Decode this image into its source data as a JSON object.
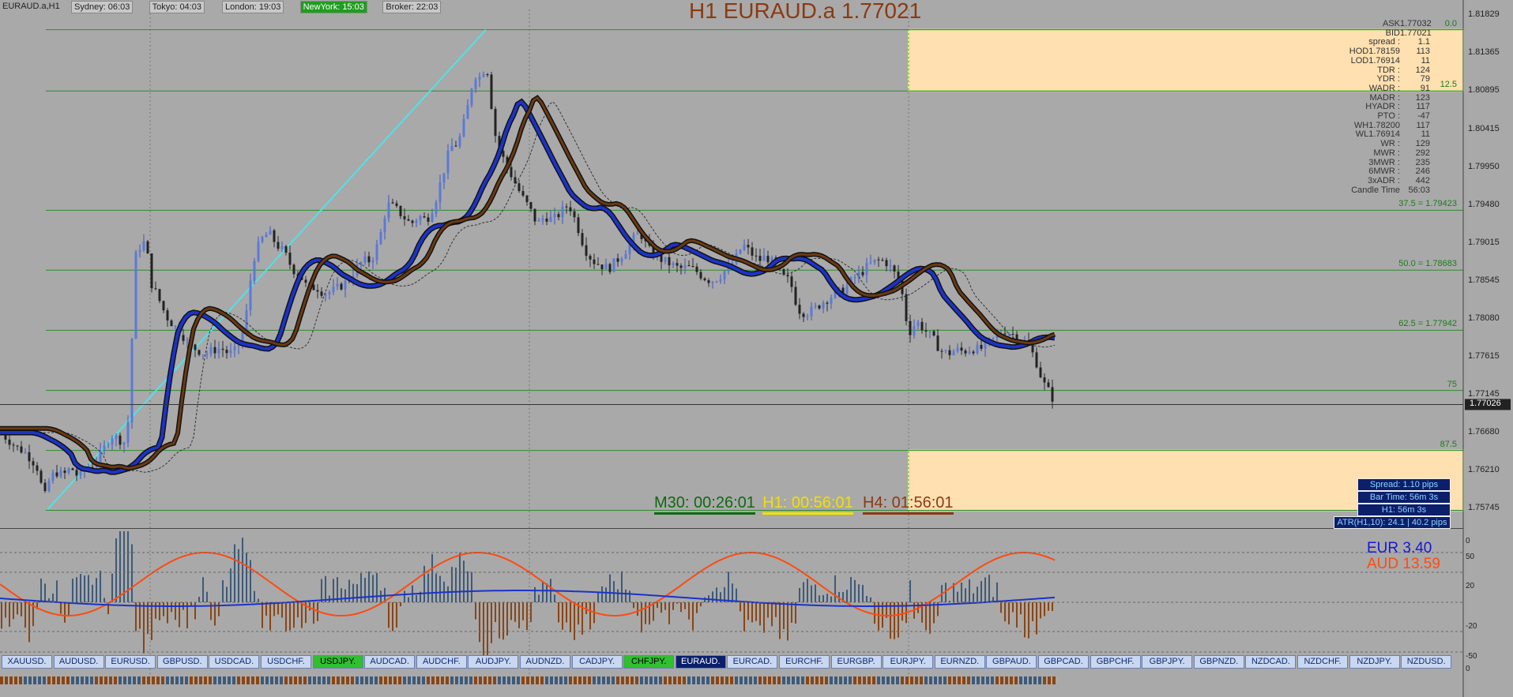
{
  "chart_title": "EURAUD.a,H1",
  "big_title": "H1 EURAUD.a 1.77021",
  "sessions": [
    {
      "label": "Sydney: 06:03",
      "bg": "#c8c8c8"
    },
    {
      "label": "Tokyo: 04:03",
      "bg": "#c8c8c8"
    },
    {
      "label": "London: 19:03",
      "bg": "#c8c8c8"
    },
    {
      "label": "NewYork: 15:03",
      "bg": "#1f9d1f"
    },
    {
      "label": "Broker: 22:03",
      "bg": "#c8c8c8"
    }
  ],
  "price_axis": [
    "1.81829",
    "1.81365",
    "1.80895",
    "1.80415",
    "1.79950",
    "1.79480",
    "1.79015",
    "1.78545",
    "1.78080",
    "1.77615",
    "1.77145",
    "1.77026",
    "1.76680",
    "1.76210",
    "1.75745"
  ],
  "info_panel": [
    {
      "k": "ASK",
      "v": "1.77032"
    },
    {
      "k": "BID",
      "v": "1.77021"
    },
    {
      "k": "spread :",
      "v": "1.1"
    },
    {
      "k": "HOD1.78159",
      "v": "113"
    },
    {
      "k": "LOD1.76914",
      "v": "11"
    },
    {
      "k": "TDR :",
      "v": "124"
    },
    {
      "k": "YDR :",
      "v": "79"
    },
    {
      "k": "WADR :",
      "v": "91"
    },
    {
      "k": "MADR :",
      "v": "123"
    },
    {
      "k": "HYADR :",
      "v": "117"
    },
    {
      "k": "PTO :",
      "v": "-47"
    },
    {
      "k": "WH1.78200",
      "v": "117"
    },
    {
      "k": "WL1.76914",
      "v": "11"
    },
    {
      "k": "WR :",
      "v": "129"
    },
    {
      "k": "MWR :",
      "v": "292"
    },
    {
      "k": "3MWR :",
      "v": "235"
    },
    {
      "k": "6MWR :",
      "v": "246"
    },
    {
      "k": "3xADR :",
      "v": "442"
    },
    {
      "k": "Candle Time",
      "v": "56:03"
    }
  ],
  "fib_labels": [
    {
      "text": "0.0"
    },
    {
      "text": "12.5"
    },
    {
      "text": "37.5 = 1.79423"
    },
    {
      "text": "50.0  = 1.78683"
    },
    {
      "text": "62.5 = 1.77942"
    },
    {
      "text": "75"
    },
    {
      "text": "87.5"
    }
  ],
  "candle_timers": [
    {
      "text": "M30: 00:26:01",
      "color": "#0f6a0f"
    },
    {
      "text": "H1: 00:56:01",
      "color": "#f2e000"
    },
    {
      "text": "H4: 01:56:01",
      "color": "#8b3a12"
    }
  ],
  "info_boxes": [
    "Spread: 1.10 pips",
    "Bar Time: 56m 3s",
    "H1:  56m 3s",
    "ATR(H1,10): 24.1  |  40.2 pips"
  ],
  "strength": [
    {
      "ccy": "EUR",
      "val": "3.40",
      "color": "#1616d8"
    },
    {
      "ccy": "AUD",
      "val": "13.59",
      "color": "#ff4a10"
    }
  ],
  "indicator_axis": [
    "0",
    "50",
    "20",
    "-20",
    "-50",
    "0"
  ],
  "pair_tabs": [
    "XAUUSD.",
    "AUDUSD.",
    "EURUSD.",
    "GBPUSD.",
    "USDCAD.",
    "USDCHF.",
    "USDJPY.",
    "AUDCAD.",
    "AUDCHF.",
    "AUDJPY.",
    "AUDNZD.",
    "CADJPY.",
    "CHFJPY.",
    "EURAUD.",
    "EURCAD.",
    "EURCHF.",
    "EURGBP.",
    "EURJPY.",
    "EURNZD.",
    "GBPAUD.",
    "GBPCAD.",
    "GBPCHF.",
    "GBPJPY.",
    "GBPNZD.",
    "NZDCAD.",
    "NZDCHF.",
    "NZDJPY.",
    "NZDUSD."
  ],
  "active_tabs": [
    "USDJPY.",
    "CHFJPY."
  ],
  "selected_tab": "EURAUD.",
  "colors": {
    "ema_slow": "#6b3a12",
    "ema_fast": "#1c33c8",
    "trend": "#4fe3e8",
    "fib": "#2f8a2f",
    "zone": "#ffe0b0"
  },
  "chart_data": {
    "type": "candlestick",
    "symbol": "EURAUD.a",
    "timeframe": "H1",
    "ylim": [
      1.7555,
      1.819
    ],
    "last_price": 1.77026,
    "fib_levels": [
      {
        "level": "0.0",
        "price": 1.8165
      },
      {
        "level": "12.5",
        "price": 1.80895
      },
      {
        "level": "37.5",
        "price": 1.79423
      },
      {
        "level": "50.0",
        "price": 1.78683
      },
      {
        "level": "62.5",
        "price": 1.77942
      },
      {
        "level": "75",
        "price": 1.772
      },
      {
        "level": "87.5",
        "price": 1.7646
      },
      {
        "level": "100",
        "price": 1.7572
      }
    ],
    "close_path": [
      [
        0,
        1.7668
      ],
      [
        10,
        1.766
      ],
      [
        20,
        1.765
      ],
      [
        30,
        1.7645
      ],
      [
        40,
        1.7635
      ],
      [
        50,
        1.762
      ],
      [
        55,
        1.758
      ],
      [
        60,
        1.7605
      ],
      [
        70,
        1.762
      ],
      [
        80,
        1.7615
      ],
      [
        90,
        1.7625
      ],
      [
        100,
        1.7612
      ],
      [
        110,
        1.7625
      ],
      [
        120,
        1.763
      ],
      [
        130,
        1.7645
      ],
      [
        140,
        1.7665
      ],
      [
        150,
        1.766
      ],
      [
        160,
        1.7655
      ],
      [
        165,
        1.772
      ],
      [
        170,
        1.788
      ],
      [
        175,
        1.7895
      ],
      [
        180,
        1.79
      ],
      [
        185,
        1.7905
      ],
      [
        190,
        1.7855
      ],
      [
        200,
        1.7835
      ],
      [
        210,
        1.7812
      ],
      [
        220,
        1.78
      ],
      [
        230,
        1.779
      ],
      [
        240,
        1.7775
      ],
      [
        250,
        1.777
      ],
      [
        260,
        1.7765
      ],
      [
        270,
        1.777
      ],
      [
        280,
        1.7772
      ],
      [
        290,
        1.7765
      ],
      [
        300,
        1.777
      ],
      [
        310,
        1.78
      ],
      [
        320,
        1.788
      ],
      [
        330,
        1.7905
      ],
      [
        340,
        1.7915
      ],
      [
        350,
        1.79
      ],
      [
        360,
        1.789
      ],
      [
        370,
        1.787
      ],
      [
        380,
        1.7862
      ],
      [
        390,
        1.7845
      ],
      [
        400,
        1.7848
      ],
      [
        410,
        1.784
      ],
      [
        420,
        1.7842
      ],
      [
        430,
        1.7848
      ],
      [
        440,
        1.7855
      ],
      [
        450,
        1.787
      ],
      [
        460,
        1.788
      ],
      [
        470,
        1.788
      ],
      [
        480,
        1.7905
      ],
      [
        490,
        1.795
      ],
      [
        500,
        1.7945
      ],
      [
        510,
        1.7935
      ],
      [
        520,
        1.7925
      ],
      [
        530,
        1.7935
      ],
      [
        540,
        1.793
      ],
      [
        550,
        1.795
      ],
      [
        560,
        1.7985
      ],
      [
        570,
        1.802
      ],
      [
        580,
        1.8025
      ],
      [
        590,
        1.806
      ],
      [
        600,
        1.811
      ],
      [
        610,
        1.8105
      ],
      [
        615,
        1.813
      ],
      [
        620,
        1.809
      ],
      [
        625,
        1.8045
      ],
      [
        630,
        1.802
      ],
      [
        640,
        1.8
      ],
      [
        650,
        1.798
      ],
      [
        660,
        1.796
      ],
      [
        670,
        1.7945
      ],
      [
        680,
        1.7925
      ],
      [
        690,
        1.7935
      ],
      [
        700,
        1.793
      ],
      [
        710,
        1.794
      ],
      [
        720,
        1.795
      ],
      [
        730,
        1.7925
      ],
      [
        740,
        1.7895
      ],
      [
        750,
        1.788
      ],
      [
        760,
        1.7875
      ],
      [
        770,
        1.787
      ],
      [
        780,
        1.788
      ],
      [
        790,
        1.789
      ],
      [
        800,
        1.7905
      ],
      [
        810,
        1.7915
      ],
      [
        820,
        1.7895
      ],
      [
        830,
        1.7885
      ],
      [
        840,
        1.788
      ],
      [
        850,
        1.7875
      ],
      [
        860,
        1.787
      ],
      [
        870,
        1.7872
      ],
      [
        880,
        1.7868
      ],
      [
        890,
        1.786
      ],
      [
        900,
        1.7855
      ],
      [
        910,
        1.786
      ],
      [
        920,
        1.787
      ],
      [
        930,
        1.788
      ],
      [
        940,
        1.79
      ],
      [
        950,
        1.789
      ],
      [
        960,
        1.788
      ],
      [
        970,
        1.7885
      ],
      [
        980,
        1.7875
      ],
      [
        990,
        1.786
      ],
      [
        1000,
        1.7855
      ],
      [
        1010,
        1.782
      ],
      [
        1020,
        1.7815
      ],
      [
        1030,
        1.782
      ],
      [
        1040,
        1.7828
      ],
      [
        1050,
        1.7835
      ],
      [
        1060,
        1.784
      ],
      [
        1070,
        1.7845
      ],
      [
        1080,
        1.7858
      ],
      [
        1090,
        1.7865
      ],
      [
        1100,
        1.7875
      ],
      [
        1110,
        1.788
      ],
      [
        1120,
        1.788
      ],
      [
        1130,
        1.7868
      ],
      [
        1140,
        1.785
      ],
      [
        1150,
        1.779
      ],
      [
        1160,
        1.7805
      ],
      [
        1170,
        1.7795
      ],
      [
        1180,
        1.7785
      ],
      [
        1190,
        1.777
      ],
      [
        1200,
        1.7765
      ],
      [
        1210,
        1.777
      ],
      [
        1220,
        1.7768
      ],
      [
        1230,
        1.7772
      ],
      [
        1240,
        1.777
      ],
      [
        1250,
        1.7778
      ],
      [
        1260,
        1.7785
      ],
      [
        1270,
        1.7795
      ],
      [
        1280,
        1.779
      ],
      [
        1290,
        1.7785
      ],
      [
        1300,
        1.7778
      ],
      [
        1310,
        1.776
      ],
      [
        1320,
        1.773
      ],
      [
        1330,
        1.7715
      ],
      [
        1335,
        1.7705
      ]
    ]
  }
}
